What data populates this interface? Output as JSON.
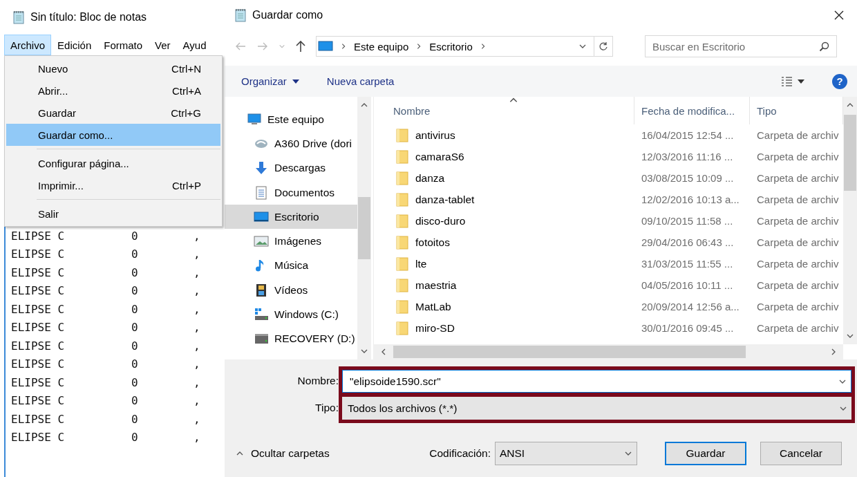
{
  "notepad": {
    "title": "Sin título: Bloc de notas",
    "menu_bar": [
      {
        "label": "Archivo",
        "selected": true
      },
      {
        "label": "Edición",
        "selected": false
      },
      {
        "label": "Formato",
        "selected": false
      },
      {
        "label": "Ver",
        "selected": false
      },
      {
        "label": "Ayud",
        "selected": false
      }
    ],
    "file_menu": {
      "groups": [
        {
          "items": [
            {
              "label": "Nuevo",
              "shortcut": "Ctrl+N",
              "selected": false
            },
            {
              "label": "Abrir...",
              "shortcut": "Ctrl+A",
              "selected": false
            },
            {
              "label": "Guardar",
              "shortcut": "Ctrl+G",
              "selected": false
            },
            {
              "label": "Guardar como...",
              "selected": true
            }
          ]
        },
        {
          "items": [
            {
              "label": "Configurar página...",
              "selected": false
            },
            {
              "label": "Imprimir...",
              "shortcut": "Ctrl+P",
              "selected": false
            }
          ]
        },
        {
          "items": [
            {
              "label": "Salir",
              "selected": false
            }
          ]
        }
      ]
    },
    "text_lines": [
      {
        "column_1": "ELIPSE C",
        "column_2": "0",
        "column_3": ","
      },
      {
        "column_1": "ELIPSE C",
        "column_2": "0",
        "column_3": ","
      },
      {
        "column_1": "ELIPSE C",
        "column_2": "0",
        "column_3": ","
      },
      {
        "column_1": "ELIPSE C",
        "column_2": "0",
        "column_3": ","
      },
      {
        "column_1": "ELIPSE C",
        "column_2": "0",
        "column_3": ","
      },
      {
        "column_1": "ELIPSE C",
        "column_2": "0",
        "column_3": ","
      },
      {
        "column_1": "ELIPSE C",
        "column_2": "0",
        "column_3": ","
      },
      {
        "column_1": "ELIPSE C",
        "column_2": "0",
        "column_3": ","
      },
      {
        "column_1": "ELIPSE C",
        "column_2": "0",
        "column_3": ","
      },
      {
        "column_1": "ELIPSE C",
        "column_2": "0",
        "column_3": ","
      },
      {
        "column_1": "ELIPSE C",
        "column_2": "0",
        "column_3": ","
      },
      {
        "column_1": "ELIPSE C",
        "column_2": "0",
        "column_3": ","
      }
    ]
  },
  "dialog": {
    "title": "Guardar como",
    "address": {
      "path": [
        "Este equipo",
        "Escritorio"
      ],
      "search_placeholder": "Buscar en Escritorio"
    },
    "toolbar": {
      "organize": "Organizar",
      "new_folder": "Nueva carpeta",
      "help": "?"
    },
    "sidebar": {
      "items": [
        {
          "kind": "pc",
          "label": "Este equipo",
          "selected": false,
          "children": [
            {
              "kind": "cloud",
              "label": "A360 Drive (dori",
              "selected": false
            },
            {
              "kind": "download",
              "label": "Descargas",
              "selected": false
            },
            {
              "kind": "document",
              "label": "Documentos",
              "selected": false
            },
            {
              "kind": "desktop",
              "label": "Escritorio",
              "selected": true
            },
            {
              "kind": "pictures",
              "label": "Imágenes",
              "selected": false
            },
            {
              "kind": "music",
              "label": "Música",
              "selected": false
            },
            {
              "kind": "videos",
              "label": "Vídeos",
              "selected": false
            },
            {
              "kind": "windows-drive",
              "label": "Windows (C:)",
              "selected": false
            },
            {
              "kind": "drive",
              "label": "RECOVERY (D:)",
              "selected": false
            }
          ]
        }
      ]
    },
    "file_list": {
      "columns": [
        "Nombre",
        "Fecha de modifica...",
        "Tipo"
      ],
      "rows": [
        {
          "name": "antivirus",
          "date": "16/04/2015 12:54 ...",
          "type": "Carpeta de archiv"
        },
        {
          "name": "camaraS6",
          "date": "12/03/2016 11:16 ...",
          "type": "Carpeta de archiv"
        },
        {
          "name": "danza",
          "date": "03/08/2015 10:09 ...",
          "type": "Carpeta de archiv"
        },
        {
          "name": "danza-tablet",
          "date": "12/02/2016 10:13 a...",
          "type": "Carpeta de archiv"
        },
        {
          "name": "disco-duro",
          "date": "09/10/2015 11:58 ...",
          "type": "Carpeta de archiv"
        },
        {
          "name": "fotoitos",
          "date": "29/04/2016 06:43 ...",
          "type": "Carpeta de archiv"
        },
        {
          "name": "lte",
          "date": "31/03/2015 11:55 ...",
          "type": "Carpeta de archiv"
        },
        {
          "name": "maestria",
          "date": "04/05/2016 10:11 ...",
          "type": "Carpeta de archiv"
        },
        {
          "name": "MatLab",
          "date": "20/09/2014 12:56 a...",
          "type": "Carpeta de archiv"
        },
        {
          "name": "miro-SD",
          "date": "30/01/2016 09:45 ...",
          "type": "Carpeta de archiv"
        }
      ]
    },
    "form": {
      "name_label": "Nombre:",
      "name_value": "\"elipsoide1590.scr\"",
      "type_label": "Tipo:",
      "type_value": "Todos los archivos  (*.*)",
      "encoding_label": "Codificación:",
      "encoding_value": "ANSI"
    },
    "hide_folders": "Ocultar carpetas",
    "buttons": [
      {
        "label": "Guardar",
        "default": true
      },
      {
        "label": "Cancelar",
        "default": false
      }
    ]
  }
}
